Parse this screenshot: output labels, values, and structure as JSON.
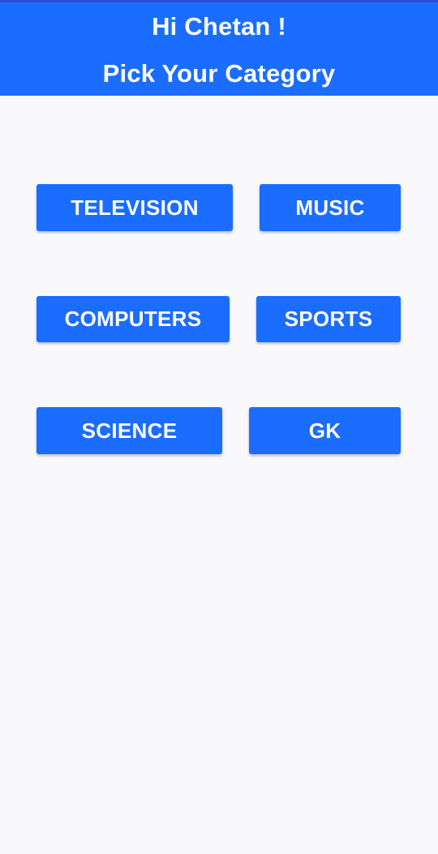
{
  "header": {
    "greeting": "Hi Chetan !",
    "subtitle": "Pick Your Category"
  },
  "categories": [
    {
      "label": "TELEVISION"
    },
    {
      "label": "MUSIC"
    },
    {
      "label": "COMPUTERS"
    },
    {
      "label": "SPORTS"
    },
    {
      "label": "SCIENCE"
    },
    {
      "label": "GK"
    }
  ],
  "colors": {
    "accent": "#1a6dff",
    "background": "#f9f9fb",
    "text_on_accent": "#ffffff"
  }
}
